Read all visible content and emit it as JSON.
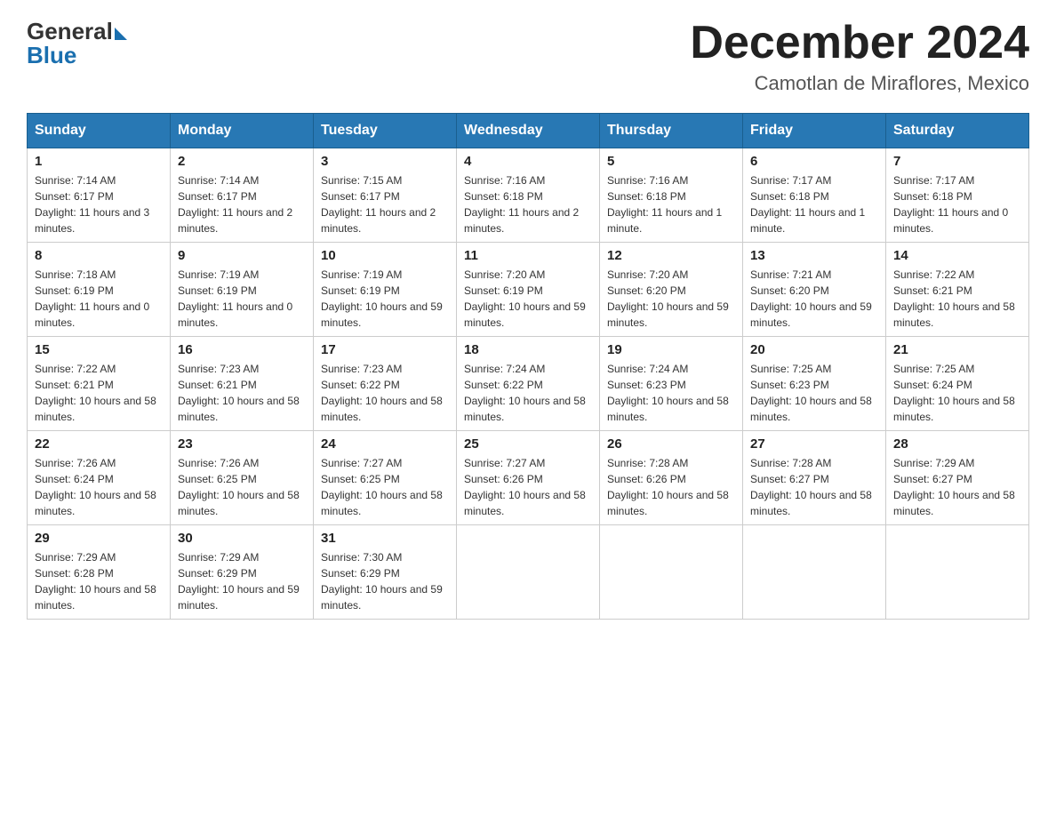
{
  "header": {
    "logo_general": "General",
    "logo_blue": "Blue",
    "month_title": "December 2024",
    "location": "Camotlan de Miraflores, Mexico"
  },
  "columns": [
    "Sunday",
    "Monday",
    "Tuesday",
    "Wednesday",
    "Thursday",
    "Friday",
    "Saturday"
  ],
  "weeks": [
    [
      {
        "day": "1",
        "sunrise": "7:14 AM",
        "sunset": "6:17 PM",
        "daylight": "11 hours and 3 minutes."
      },
      {
        "day": "2",
        "sunrise": "7:14 AM",
        "sunset": "6:17 PM",
        "daylight": "11 hours and 2 minutes."
      },
      {
        "day": "3",
        "sunrise": "7:15 AM",
        "sunset": "6:17 PM",
        "daylight": "11 hours and 2 minutes."
      },
      {
        "day": "4",
        "sunrise": "7:16 AM",
        "sunset": "6:18 PM",
        "daylight": "11 hours and 2 minutes."
      },
      {
        "day": "5",
        "sunrise": "7:16 AM",
        "sunset": "6:18 PM",
        "daylight": "11 hours and 1 minute."
      },
      {
        "day": "6",
        "sunrise": "7:17 AM",
        "sunset": "6:18 PM",
        "daylight": "11 hours and 1 minute."
      },
      {
        "day": "7",
        "sunrise": "7:17 AM",
        "sunset": "6:18 PM",
        "daylight": "11 hours and 0 minutes."
      }
    ],
    [
      {
        "day": "8",
        "sunrise": "7:18 AM",
        "sunset": "6:19 PM",
        "daylight": "11 hours and 0 minutes."
      },
      {
        "day": "9",
        "sunrise": "7:19 AM",
        "sunset": "6:19 PM",
        "daylight": "11 hours and 0 minutes."
      },
      {
        "day": "10",
        "sunrise": "7:19 AM",
        "sunset": "6:19 PM",
        "daylight": "10 hours and 59 minutes."
      },
      {
        "day": "11",
        "sunrise": "7:20 AM",
        "sunset": "6:19 PM",
        "daylight": "10 hours and 59 minutes."
      },
      {
        "day": "12",
        "sunrise": "7:20 AM",
        "sunset": "6:20 PM",
        "daylight": "10 hours and 59 minutes."
      },
      {
        "day": "13",
        "sunrise": "7:21 AM",
        "sunset": "6:20 PM",
        "daylight": "10 hours and 59 minutes."
      },
      {
        "day": "14",
        "sunrise": "7:22 AM",
        "sunset": "6:21 PM",
        "daylight": "10 hours and 58 minutes."
      }
    ],
    [
      {
        "day": "15",
        "sunrise": "7:22 AM",
        "sunset": "6:21 PM",
        "daylight": "10 hours and 58 minutes."
      },
      {
        "day": "16",
        "sunrise": "7:23 AM",
        "sunset": "6:21 PM",
        "daylight": "10 hours and 58 minutes."
      },
      {
        "day": "17",
        "sunrise": "7:23 AM",
        "sunset": "6:22 PM",
        "daylight": "10 hours and 58 minutes."
      },
      {
        "day": "18",
        "sunrise": "7:24 AM",
        "sunset": "6:22 PM",
        "daylight": "10 hours and 58 minutes."
      },
      {
        "day": "19",
        "sunrise": "7:24 AM",
        "sunset": "6:23 PM",
        "daylight": "10 hours and 58 minutes."
      },
      {
        "day": "20",
        "sunrise": "7:25 AM",
        "sunset": "6:23 PM",
        "daylight": "10 hours and 58 minutes."
      },
      {
        "day": "21",
        "sunrise": "7:25 AM",
        "sunset": "6:24 PM",
        "daylight": "10 hours and 58 minutes."
      }
    ],
    [
      {
        "day": "22",
        "sunrise": "7:26 AM",
        "sunset": "6:24 PM",
        "daylight": "10 hours and 58 minutes."
      },
      {
        "day": "23",
        "sunrise": "7:26 AM",
        "sunset": "6:25 PM",
        "daylight": "10 hours and 58 minutes."
      },
      {
        "day": "24",
        "sunrise": "7:27 AM",
        "sunset": "6:25 PM",
        "daylight": "10 hours and 58 minutes."
      },
      {
        "day": "25",
        "sunrise": "7:27 AM",
        "sunset": "6:26 PM",
        "daylight": "10 hours and 58 minutes."
      },
      {
        "day": "26",
        "sunrise": "7:28 AM",
        "sunset": "6:26 PM",
        "daylight": "10 hours and 58 minutes."
      },
      {
        "day": "27",
        "sunrise": "7:28 AM",
        "sunset": "6:27 PM",
        "daylight": "10 hours and 58 minutes."
      },
      {
        "day": "28",
        "sunrise": "7:29 AM",
        "sunset": "6:27 PM",
        "daylight": "10 hours and 58 minutes."
      }
    ],
    [
      {
        "day": "29",
        "sunrise": "7:29 AM",
        "sunset": "6:28 PM",
        "daylight": "10 hours and 58 minutes."
      },
      {
        "day": "30",
        "sunrise": "7:29 AM",
        "sunset": "6:29 PM",
        "daylight": "10 hours and 59 minutes."
      },
      {
        "day": "31",
        "sunrise": "7:30 AM",
        "sunset": "6:29 PM",
        "daylight": "10 hours and 59 minutes."
      },
      null,
      null,
      null,
      null
    ]
  ]
}
